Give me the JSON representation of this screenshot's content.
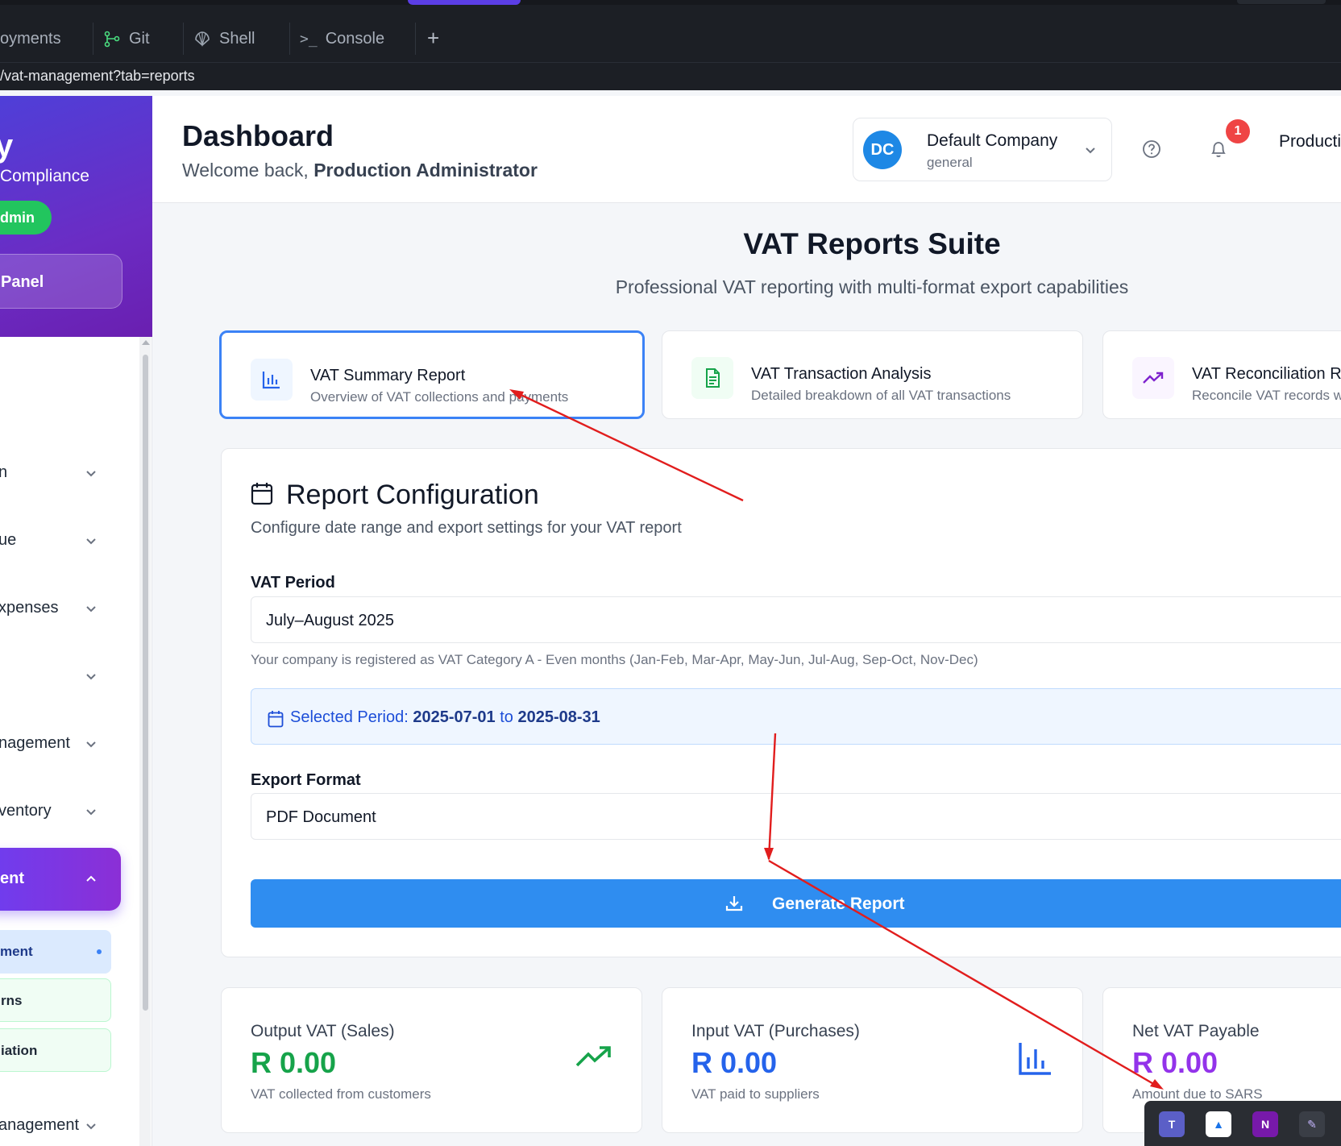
{
  "ide": {
    "tabs": [
      {
        "label": "oyments",
        "icon": "none"
      },
      {
        "label": "Git",
        "icon": "git-branch-icon"
      },
      {
        "label": "Shell",
        "icon": "shell-icon"
      },
      {
        "label": "Console",
        "icon": "console-icon"
      }
    ],
    "add_tab": "+",
    "url": "/vat-management?tab=reports"
  },
  "sidebar": {
    "brand_mark": "y",
    "brand_sub": "Compliance",
    "role_pill": "dmin",
    "panel_button": "Panel",
    "items": [
      {
        "label": "n"
      },
      {
        "label": "ue"
      },
      {
        "label": "xpenses"
      },
      {
        "label": ""
      },
      {
        "label": "nagement"
      },
      {
        "label": "ventory"
      }
    ],
    "active_item": "ent",
    "sub_items": [
      {
        "label": "ment"
      },
      {
        "label": "rns"
      },
      {
        "label": "iation"
      }
    ],
    "last_item": "anagement"
  },
  "header": {
    "title": "Dashboard",
    "welcome_prefix": "Welcome back,",
    "user_full": "Production Administrator",
    "company": {
      "initials": "DC",
      "name": "Default Company",
      "type": "general"
    },
    "notification_count": "1",
    "user_short": "Producti"
  },
  "suite": {
    "title": "VAT Reports Suite",
    "subtitle": "Professional VAT reporting with multi-format export capabilities"
  },
  "report_types": [
    {
      "title": "VAT Summary Report",
      "desc": "Overview of VAT collections and payments",
      "icon": "bar-chart-icon",
      "selected": true
    },
    {
      "title": "VAT Transaction Analysis",
      "desc": "Detailed breakdown of all VAT transactions",
      "icon": "document-icon",
      "selected": false
    },
    {
      "title": "VAT Reconciliation Re",
      "desc": "Reconcile VAT records w",
      "icon": "trending-up-icon",
      "selected": false
    }
  ],
  "config": {
    "title": "Report Configuration",
    "subtitle": "Configure date range and export settings for your VAT report",
    "period_label": "VAT Period",
    "period_value": "July–August 2025",
    "period_hint": "Your company is registered as VAT Category A - Even months (Jan-Feb, Mar-Apr, May-Jun, Jul-Aug, Sep-Oct, Nov-Dec)",
    "selected_prefix": "Selected Period:",
    "selected_start": "2025-07-01",
    "selected_to": "to",
    "selected_end": "2025-08-31",
    "export_label": "Export Format",
    "export_value": "PDF Document",
    "generate_label": "Generate Report"
  },
  "stats": [
    {
      "label": "Output VAT (Sales)",
      "value": "R 0.00",
      "desc": "VAT collected from customers",
      "color": "#16a34a",
      "icon": "trending-up-icon"
    },
    {
      "label": "Input VAT (Purchases)",
      "value": "R 0.00",
      "desc": "VAT paid to suppliers",
      "color": "#2563eb",
      "icon": "bar-chart-icon"
    },
    {
      "label": "Net VAT Payable",
      "value": "R 0.00",
      "desc": "Amount due to SARS",
      "color": "#9333ea",
      "icon": "none"
    }
  ],
  "taskbar": [
    {
      "icon": "teams-icon",
      "text": "T"
    },
    {
      "icon": "drive-icon",
      "text": "▲"
    },
    {
      "icon": "onenote-icon",
      "text": "N"
    },
    {
      "icon": "pen-icon",
      "text": "✎"
    }
  ],
  "colors": {
    "accent": "#3b82f6",
    "sidebar_gradient_start": "#4f3fd8",
    "sidebar_gradient_end": "#6a1fb0",
    "annotation_arrow": "#e11d1d"
  }
}
